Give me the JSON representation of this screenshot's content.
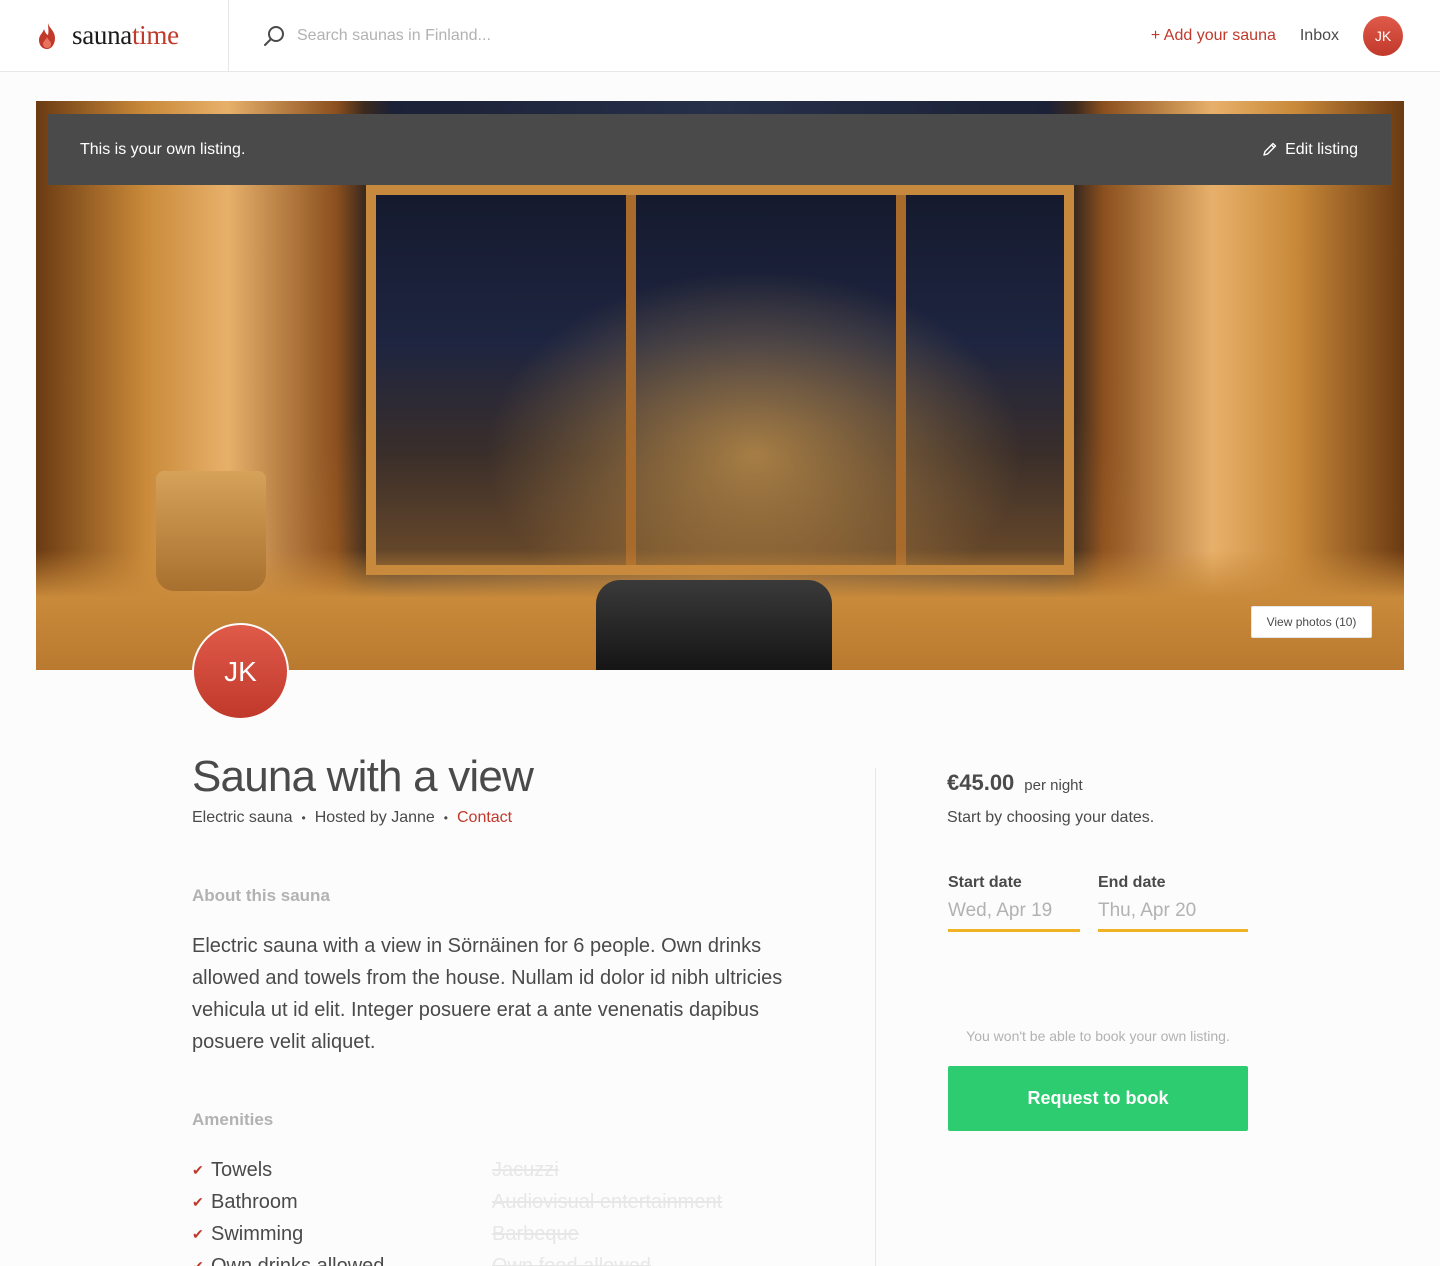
{
  "topbar": {
    "logo_part1": "sauna",
    "logo_part2": "time",
    "search_placeholder": "Search saunas in Finland...",
    "add_sauna_label": "+ Add your sauna",
    "inbox_label": "Inbox",
    "user_initials": "JK"
  },
  "hero": {
    "owner_banner_text": "This is your own listing.",
    "edit_listing_label": "Edit listing",
    "view_photos_label": "View photos (10)"
  },
  "listing": {
    "author_initials": "JK",
    "title": "Sauna with a view",
    "category": "Electric sauna",
    "hosted_by": "Hosted by Janne",
    "contact_label": "Contact",
    "about_heading": "About this sauna",
    "description": "Electric sauna with a view in Sörnäinen for 6 people. Own drinks allowed and towels from the house. Nullam id dolor id nibh ultricies vehicula ut id elit. Integer posuere erat a ante venenatis dapibus posuere velit aliquet.",
    "amenities_heading": "Amenities",
    "amenities_included": [
      "Towels",
      "Bathroom",
      "Swimming",
      "Own drinks allowed"
    ],
    "amenities_excluded": [
      "Jacuzzi",
      "Audiovisual entertainment",
      "Barbeque",
      "Own food allowed"
    ]
  },
  "booking": {
    "price": "€45.00",
    "price_unit": "per night",
    "choose_dates_text": "Start by choosing your dates.",
    "start_label": "Start date",
    "start_placeholder": "Wed, Apr 19",
    "end_label": "End date",
    "end_placeholder": "Thu, Apr 20",
    "own_listing_note": "You won't be able to book your own listing.",
    "request_button_label": "Request to book"
  },
  "colors": {
    "brand": "#c0392b",
    "text": "#4a4a4a",
    "muted": "#b2b2b2",
    "date_underline": "#f0b323",
    "book_button": "#2ecc71"
  }
}
